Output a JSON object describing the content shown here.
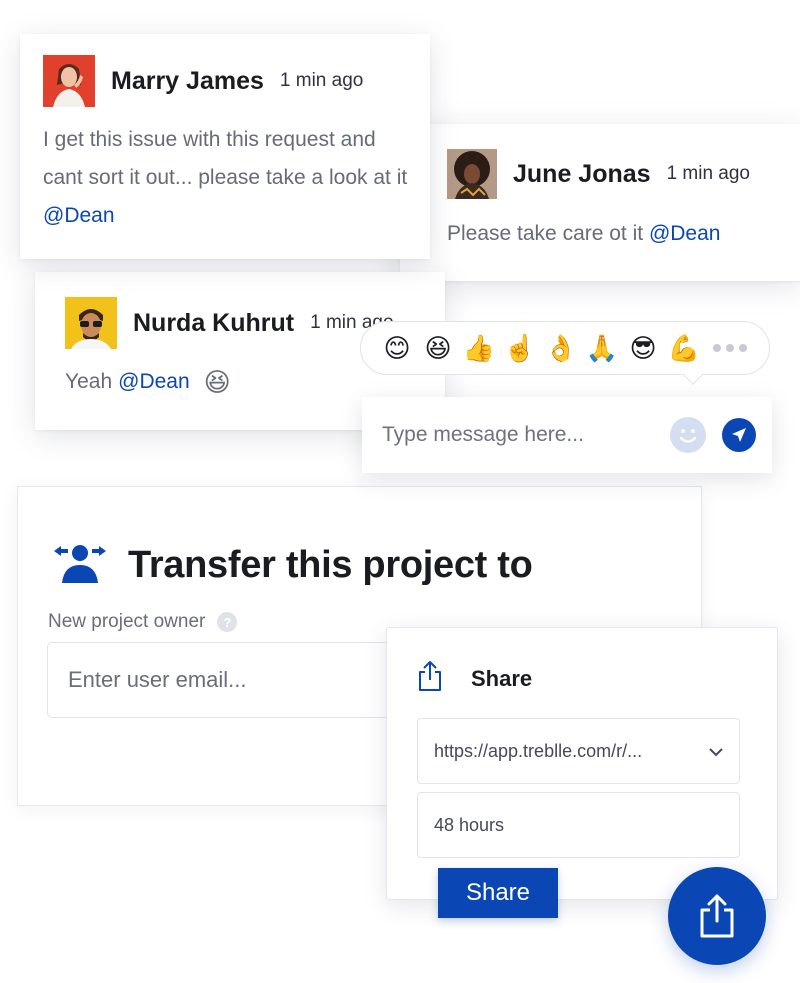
{
  "comments": [
    {
      "author": "Marry James",
      "time": "1 min ago",
      "text": "I get this issue with this request and cant sort it out... please take a look at it",
      "mention": "@Dean"
    },
    {
      "author": "June Jonas",
      "time": "1 min ago",
      "text": "Please take care ot it",
      "mention": "@Dean"
    },
    {
      "author": "Nurda Kuhrut",
      "time": "1 min ago",
      "text": "Yeah",
      "mention": "@Dean",
      "emoji": "😆"
    }
  ],
  "emoji_bar": {
    "emojis": [
      "😊",
      "😆",
      "👍",
      "☝️",
      "👌",
      "🙏",
      "😎",
      "💪"
    ]
  },
  "message": {
    "placeholder": "Type message here..."
  },
  "transfer": {
    "title": "Transfer this project to",
    "owner_label": "New project owner",
    "help_symbol": "?",
    "email_placeholder": "Enter user email..."
  },
  "share": {
    "title": "Share",
    "link_value": "https://app.treblle.com/r/...",
    "duration_value": "48 hours",
    "button_label": "Share"
  },
  "colors": {
    "accent": "#0a47b4",
    "avatar_1": "#e0402c",
    "avatar_3": "#f2c21a",
    "muted_text": "#666b78"
  }
}
